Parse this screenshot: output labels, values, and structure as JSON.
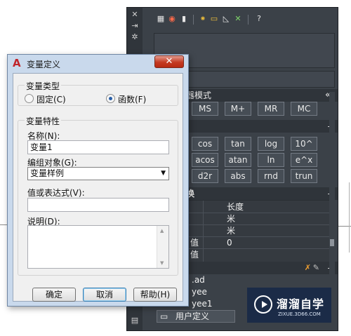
{
  "calc": {
    "memory_header": "器模式",
    "memory_buttons": [
      "MS",
      "M+",
      "MR",
      "MC"
    ],
    "function_rows": [
      [
        "cos",
        "tan",
        "log",
        "10^"
      ],
      [
        "acos",
        "atan",
        "ln",
        "e^x"
      ],
      [
        "d2r",
        "abs",
        "rnd",
        "trun"
      ]
    ],
    "conversion_header": "换",
    "conversion_cells": {
      "unit_type": "长度",
      "from": "米",
      "to": "米",
      "value_label": "值",
      "value": "0",
      "result_label": "值"
    },
    "variables": [
      ".ad",
      "yee",
      "yee1"
    ],
    "new_var_button": "用户定义",
    "collapse_glyph": "-",
    "expand_glyph": "«"
  },
  "dialog": {
    "title": "变量定义",
    "close": "✕",
    "var_type_group": "变量类型",
    "radio_fixed": "固定(C)",
    "radio_function": "函数(F)",
    "selected_radio": "function",
    "props_group": "变量特性",
    "name_label": "名称(N):",
    "name_value": "变量1",
    "group_label": "编组对象(G):",
    "group_value": "变量样例",
    "expr_label": "值或表达式(V):",
    "expr_value": "",
    "desc_label": "说明(D):",
    "desc_value": "",
    "ok": "确定",
    "cancel": "取消",
    "help": "帮助(H)"
  },
  "watermark": {
    "title": "溜溜自学",
    "subtitle": "ZIXUE.3D66.COM"
  }
}
